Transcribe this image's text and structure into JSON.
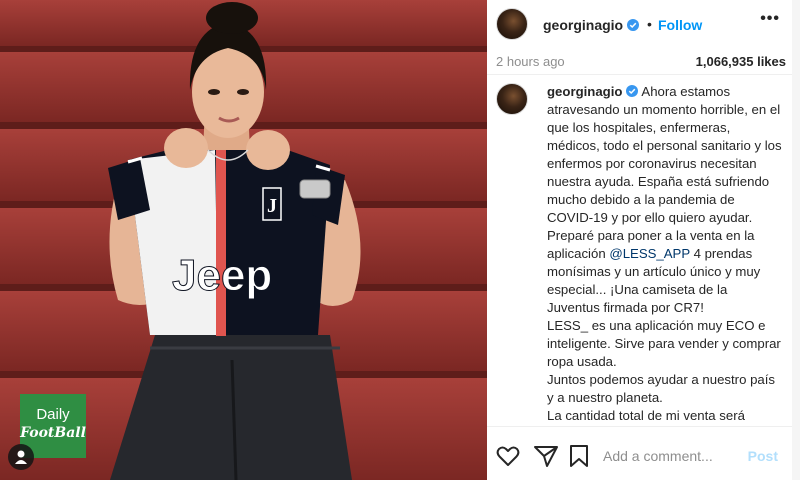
{
  "post": {
    "username": "georginagio",
    "verified": true,
    "follow_label": "Follow",
    "separator": "•",
    "more_label": "•••",
    "time": "2 hours ago",
    "likes": "1,066,935 likes"
  },
  "caption": {
    "username": "georginagio",
    "paragraphs": [
      "Ahora estamos atravesando un momento horrible, en el que los hospitales, enfermeras, médicos, todo el personal sanitario y los enfermos por coronavirus necesitan nuestra ayuda. España está sufriendo mucho debido a la pandemia de COVID-19 y por ello quiero ayudar."
    ],
    "p2_before": "Preparé para poner a la venta en la aplicación ",
    "p2_mention": "@LESS_APP",
    "p2_after": " 4 prendas monísimas y un artículo único y muy especial... ¡Una camiseta de la Juventus firmada por CR7!",
    "p3": "LESS_ es una aplicación muy ECO e inteligente. Sirve para vender y comprar ropa usada.",
    "p4": "Juntos podemos ayudar a nuestro país y a nuestro planeta.",
    "p5": "La cantidad total de mi venta será"
  },
  "photo": {
    "jersey_text": "Jeep",
    "watermark_top": "Daily",
    "watermark_bottom": "FootBall"
  },
  "actions": {
    "comment_placeholder": "Add a comment...",
    "post_label": "Post"
  },
  "colors": {
    "accent": "#0095f6",
    "verified": "#3897f0",
    "mention": "#00376b",
    "watermark_bg": "#2f8e43",
    "stairs": "#8f2f2b"
  },
  "icons": [
    "verified-badge-icon",
    "heart-icon",
    "share-icon",
    "bookmark-icon",
    "more-icon",
    "tag-person-icon"
  ]
}
